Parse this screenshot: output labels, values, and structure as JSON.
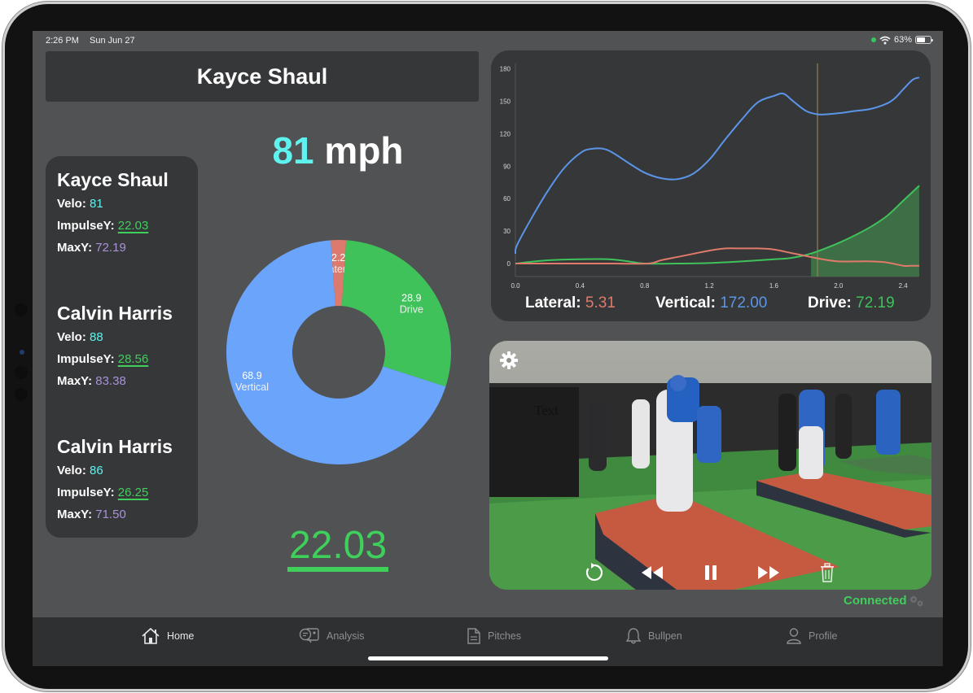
{
  "status_bar": {
    "time": "2:26 PM",
    "date": "Sun Jun 27",
    "battery": "63%",
    "battery_level": 0.63,
    "wifi_icon": "wifi-icon",
    "indicator_color": "#34c759"
  },
  "header": {
    "title": "Kayce Shaul"
  },
  "speed": {
    "value": "81",
    "unit": "mph"
  },
  "players": [
    {
      "name": "Kayce Shaul",
      "velo_label": "Velo:",
      "velo": "81",
      "impulse_label": "ImpulseY:",
      "impulse": "22.03",
      "maxy_label": "MaxY:",
      "maxy": "72.19"
    },
    {
      "name": "Calvin Harris",
      "velo_label": "Velo:",
      "velo": "88",
      "impulse_label": "ImpulseY:",
      "impulse": "28.56",
      "maxy_label": "MaxY:",
      "maxy": "83.38"
    },
    {
      "name": "Calvin Harris",
      "velo_label": "Velo:",
      "velo": "86",
      "impulse_label": "ImpulseY:",
      "impulse": "26.25",
      "maxy_label": "MaxY:",
      "maxy": "71.50"
    }
  ],
  "big_value": "22.03",
  "chart_data": [
    {
      "type": "pie",
      "variant": "donut",
      "slices": [
        {
          "label": "Lateral",
          "value": 2.2,
          "color": "#dc7a6e"
        },
        {
          "label": "Drive",
          "value": 28.9,
          "color": "#3fc25a"
        },
        {
          "label": "Vertical",
          "value": 68.9,
          "color": "#6aa4fb"
        }
      ]
    },
    {
      "type": "line",
      "title": "",
      "xlabel": "",
      "ylabel": "",
      "xlim": [
        0.0,
        2.5
      ],
      "ylim": [
        -12,
        185
      ],
      "x_ticks": [
        "0.0",
        "0.4",
        "0.8",
        "1.2",
        "1.6",
        "2.0",
        "2.4"
      ],
      "y_ticks": [
        "180",
        "150",
        "120",
        "90",
        "60",
        "30",
        "0"
      ],
      "marker_x": 1.87,
      "shaded_from_x": 1.83,
      "series": [
        {
          "name": "Vertical",
          "color": "#5b95e8",
          "x": [
            0.0,
            0.01,
            0.1,
            0.2,
            0.3,
            0.4,
            0.47,
            0.57,
            0.7,
            0.8,
            0.9,
            1.0,
            1.1,
            1.2,
            1.3,
            1.4,
            1.5,
            1.6,
            1.66,
            1.72,
            1.8,
            1.87,
            1.93,
            2.0,
            2.1,
            2.2,
            2.3,
            2.35,
            2.4,
            2.46,
            2.5
          ],
          "y": [
            9,
            17,
            42,
            67,
            88,
            102,
            106,
            105,
            93,
            84,
            79,
            78,
            83,
            96,
            115,
            133,
            149,
            155,
            157,
            150,
            141,
            138,
            138,
            139,
            141,
            143,
            148,
            153,
            161,
            170,
            172
          ]
        },
        {
          "name": "Drive",
          "color": "#3fc25a",
          "x": [
            0.0,
            0.2,
            0.4,
            0.58,
            0.7,
            0.8,
            1.0,
            1.2,
            1.4,
            1.6,
            1.7,
            1.8,
            1.9,
            2.0,
            2.1,
            2.2,
            2.3,
            2.4,
            2.5
          ],
          "y": [
            0,
            3,
            4,
            4,
            2,
            0,
            0,
            0.5,
            2,
            4,
            5,
            8,
            13,
            19,
            26,
            34,
            44,
            58,
            72
          ]
        },
        {
          "name": "Lateral",
          "color": "#e07a6a",
          "x": [
            0.0,
            0.3,
            0.6,
            0.82,
            0.9,
            1.0,
            1.1,
            1.2,
            1.3,
            1.4,
            1.5,
            1.6,
            1.7,
            1.8,
            1.9,
            2.0,
            2.1,
            2.2,
            2.3,
            2.4,
            2.45,
            2.5
          ],
          "y": [
            0,
            0,
            0,
            0,
            3,
            6,
            9,
            12,
            14,
            14,
            14,
            13,
            10,
            7,
            4,
            2,
            2,
            2,
            1,
            -2,
            -2,
            -2
          ]
        }
      ],
      "readouts": [
        {
          "label": "Lateral:",
          "value": "5.31",
          "color": "#e07a6a"
        },
        {
          "label": "Vertical:",
          "value": "172.00",
          "color": "#5b95e8"
        },
        {
          "label": "Drive:",
          "value": "72.19",
          "color": "#3fc25a"
        }
      ]
    }
  ],
  "video": {
    "overlay_text": "Text",
    "controls": [
      "replay-icon",
      "rewind-icon",
      "pause-icon",
      "fast-forward-icon",
      "trash-icon"
    ]
  },
  "connection": {
    "status": "Connected",
    "color": "#3fcf5b"
  },
  "tabs": [
    {
      "label": "Home",
      "icon": "home-icon",
      "active": true
    },
    {
      "label": "Analysis",
      "icon": "analysis-icon",
      "active": false
    },
    {
      "label": "Pitches",
      "icon": "document-icon",
      "active": false
    },
    {
      "label": "Bullpen",
      "icon": "bell-icon",
      "active": false
    },
    {
      "label": "Profile",
      "icon": "person-icon",
      "active": false
    }
  ]
}
